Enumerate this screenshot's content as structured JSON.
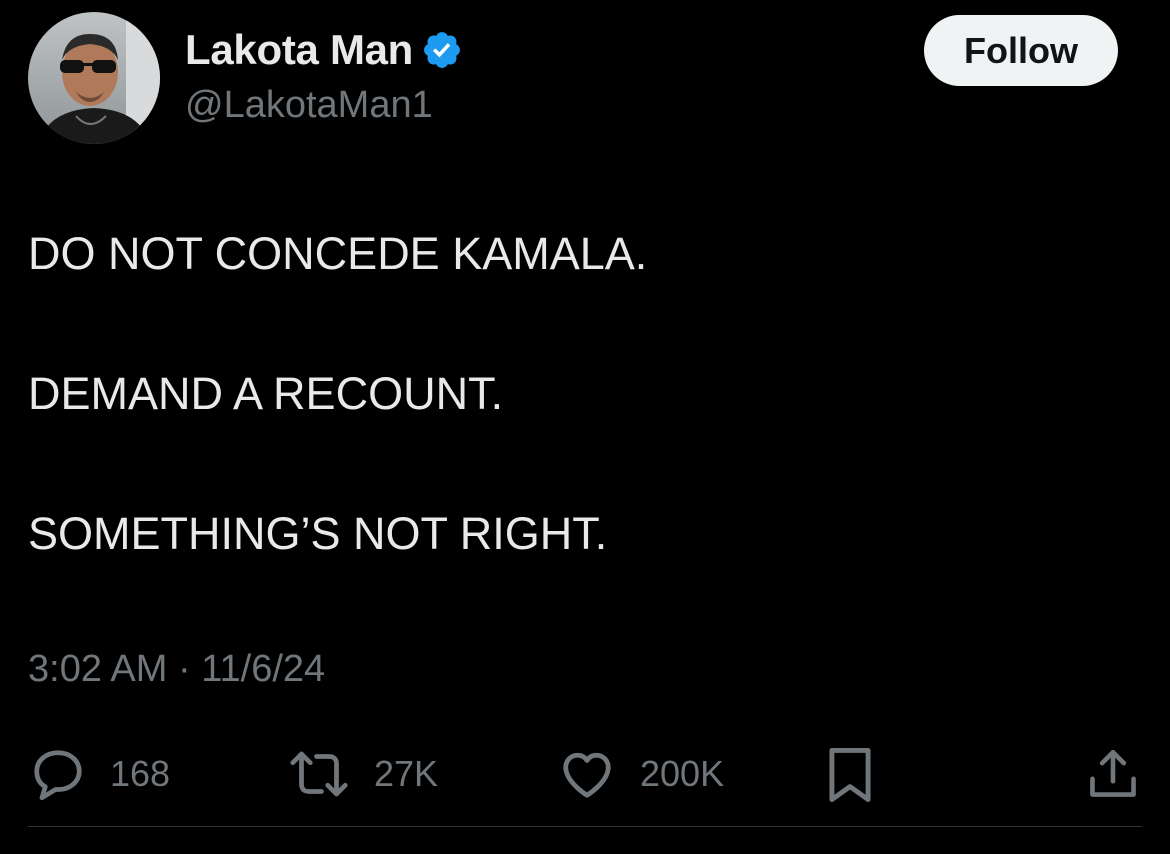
{
  "author": {
    "display_name": "Lakota Man",
    "handle": "@LakotaMan1",
    "verified": true,
    "verified_color": "#1d9bf0"
  },
  "follow_button": {
    "label": "Follow"
  },
  "tweet": {
    "lines": [
      "DO NOT CONCEDE KAMALA.",
      "DEMAND A RECOUNT.",
      "SOMETHING’S NOT RIGHT."
    ],
    "timestamp": "3:02 AM · 11/6/24"
  },
  "actions": {
    "replies": "168",
    "reposts": "27K",
    "likes": "200K"
  },
  "icons": [
    "reply-icon",
    "repost-icon",
    "like-icon",
    "bookmark-icon",
    "share-icon",
    "verified-badge-icon"
  ]
}
